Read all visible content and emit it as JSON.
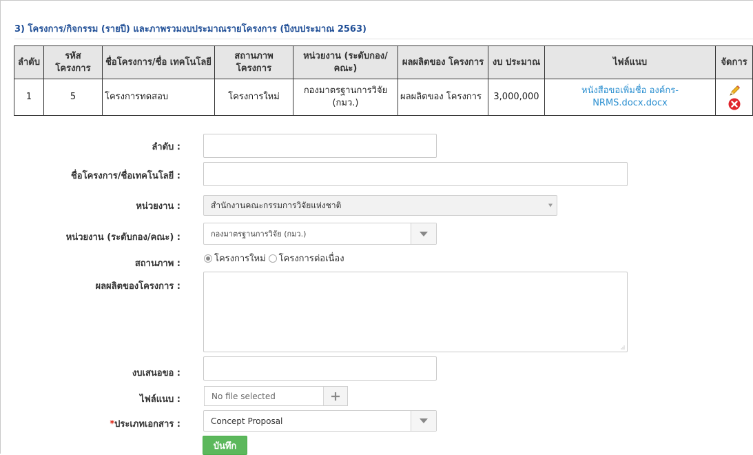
{
  "section": {
    "title": "3) โครงการ/กิจกรรม (รายปี) และภาพรวมงบประมาณรายโครงการ (ปีงบประมาณ 2563)"
  },
  "table": {
    "headers": [
      "ลำดับ",
      "รหัส โครงการ",
      "ชื่อโครงการ/ชื่อ เทคโนโลยี",
      "สถานภาพ โครงการ",
      "หน่วยงาน (ระดับกอง/ คณะ)",
      "ผลผลิตของ โครงการ",
      "งบ ประมาณ",
      "ไฟล์แนบ",
      "จัดการ"
    ],
    "rows": [
      {
        "order": "1",
        "code": "5",
        "name": "โครงการทดสอบ",
        "status": "โครงการใหม่",
        "unit": "กองมาตรฐานการวิจัย (กมว.)",
        "output": "ผลผลิตของ โครงการ",
        "budget": "3,000,000",
        "file": "หนังสือขอเพิ่มชื่อ องค์กร-NRMS.docx.docx"
      }
    ]
  },
  "form": {
    "order_label": "ลำดับ :",
    "order_value": "",
    "name_label": "ชื่อโครงการ/ชื่อเทคโนโลยี :",
    "name_value": "",
    "agency_label": "หน่วยงาน :",
    "agency_value": "สำนักงานคณะกรรมการวิจัยแห่งชาติ",
    "division_label": "หน่วยงาน (ระดับกอง/คณะ) :",
    "division_value": "กองมาตรฐานการวิจัย (กมว.)",
    "status_label": "สถานภาพ :",
    "status_options": [
      "โครงการใหม่",
      "โครงการต่อเนื่อง"
    ],
    "status_selected": "โครงการใหม่",
    "output_label": "ผลผลิตของโครงการ :",
    "output_value": "",
    "budget_label": "งบเสนอขอ :",
    "budget_value": "",
    "file_label": "ไฟล์แนบ :",
    "file_placeholder": "No file selected",
    "doctype_required_mark": "*",
    "doctype_label": "ประเภทเอกสาร :",
    "doctype_value": "Concept Proposal",
    "save_label": "บันทึก"
  },
  "colors": {
    "title": "#1f4e96",
    "link": "#2b8fd0",
    "save": "#5cb85c",
    "delete": "#e0242c"
  }
}
